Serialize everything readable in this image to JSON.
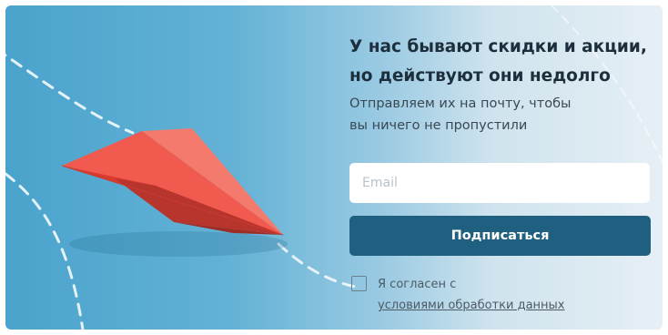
{
  "promo": {
    "heading_line1": "У нас бывают скидки и акции,",
    "heading_line2": "но действуют они недолго",
    "subtext_line1": "Отправляем их на почту, чтобы",
    "subtext_line2": "вы ничего не пропустили"
  },
  "form": {
    "email_placeholder": "Email",
    "email_value": "",
    "subscribe_label": "Подписаться",
    "consent_checked": false,
    "consent_text": "Я согласен с",
    "consent_link": "условиями обработки данных"
  },
  "icons": {
    "illustration": "paper-plane-illustration",
    "checkbox": "checkbox-icon"
  },
  "colors": {
    "background_left": "#4aa3cc",
    "background_right": "#e6eff5",
    "plane": "#e8453c",
    "button": "#1f5f7f",
    "heading": "#1d2f3d"
  }
}
